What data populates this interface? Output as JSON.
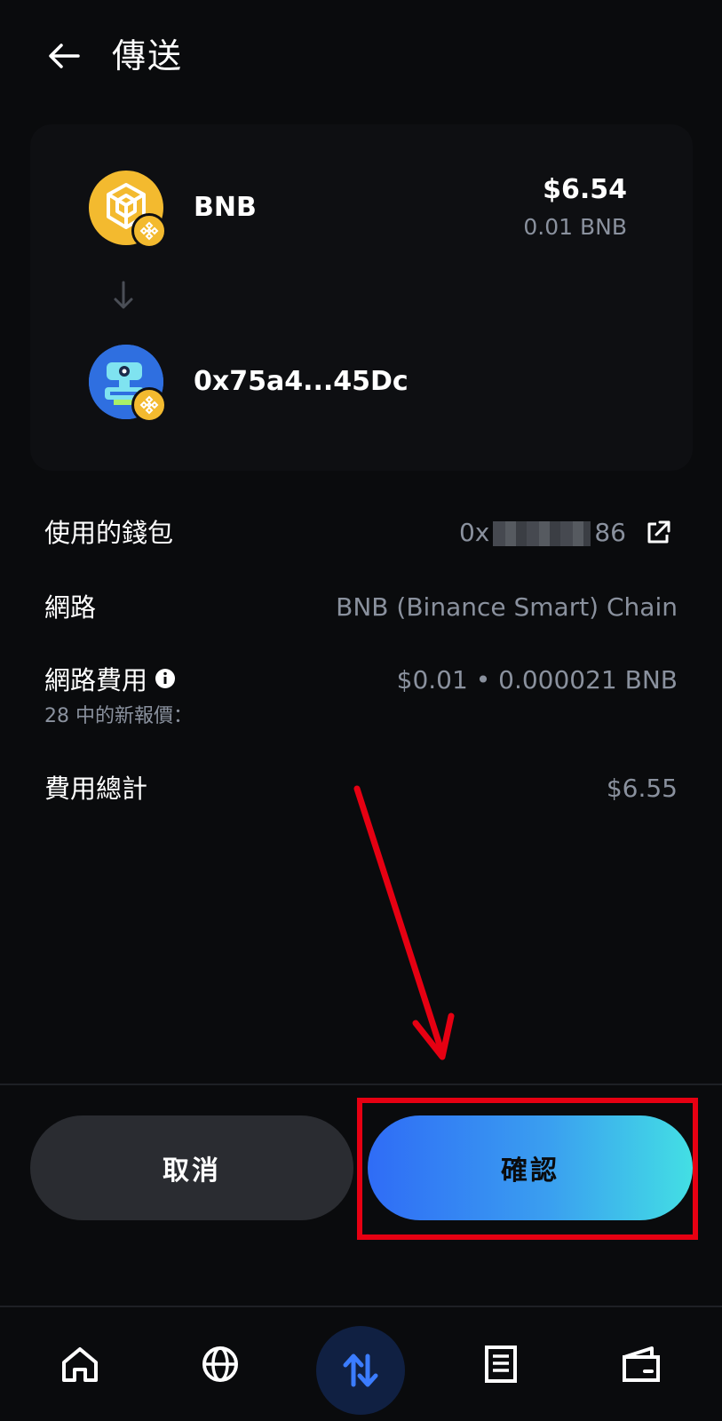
{
  "header": {
    "title": "傳送",
    "back_icon": "arrow-left-icon"
  },
  "transfer": {
    "from": {
      "asset_name": "BNB",
      "amount_usd": "$6.54",
      "amount_token": "0.01 BNB",
      "icon": "bnb-token-icon"
    },
    "to": {
      "address": "0x75a4...45Dc",
      "icon": "address-avatar-icon"
    }
  },
  "details": {
    "wallet": {
      "label": "使用的錢包",
      "value_prefix": "0x",
      "value_suffix": "86"
    },
    "network": {
      "label": "網路",
      "value": "BNB (Binance Smart) Chain"
    },
    "fee": {
      "label": "網路費用",
      "sublabel": "28 中的新報價：",
      "value": "$0.01 • 0.000021 BNB"
    },
    "total": {
      "label": "費用總計",
      "value": "$6.55"
    }
  },
  "actions": {
    "cancel_label": "取消",
    "confirm_label": "確認"
  },
  "colors": {
    "background": "#0a0b0d",
    "bnb_yellow": "#f3ba2f",
    "confirm_gradient_start": "#2f6cf6",
    "confirm_gradient_end": "#43dfe4",
    "annotation_red": "#e60012",
    "muted_text": "#8a919e"
  },
  "bottom_nav": {
    "items": [
      "home-icon",
      "globe-icon",
      "swap-arrows-icon",
      "document-list-icon",
      "wallet-icon"
    ],
    "active": "swap-arrows-icon"
  }
}
